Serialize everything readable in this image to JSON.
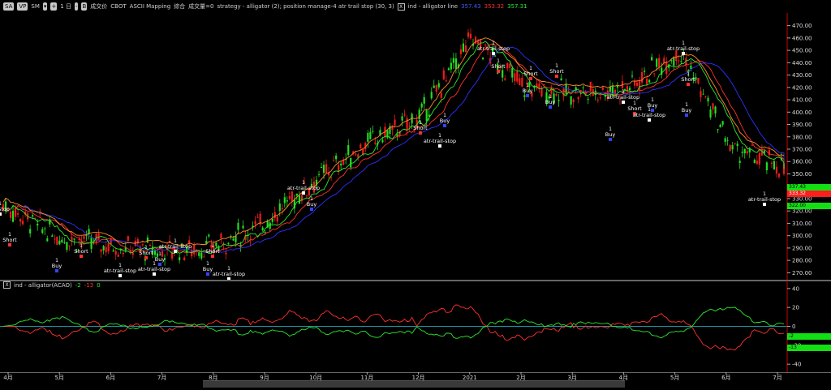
{
  "toolbar": {
    "symbol_btn": "SA",
    "vp_btn": "VP",
    "sm": "SM",
    "period": "1 日",
    "exchange": "成交价",
    "source": "CBOT",
    "mapping": "ASCII Mapping",
    "mode": "综合",
    "volume": "成交量=0",
    "strategy": "strategy - alligator (2); position manage-4 atr trail stop (30, 3)",
    "indicator": "ind - alligator line",
    "val_blue": "357.43",
    "val_red": "353.32",
    "val_green": "357.31",
    "checkbox_x": "X",
    "dropdown_arrow": "▾",
    "plus": "+",
    "minus": "-",
    "b": "B"
  },
  "oscillator": {
    "title": "ind - alligator(ACAO)",
    "v1": "-2",
    "v2": "-13",
    "v3": "0",
    "checkbox_x": "X"
  },
  "price_axis": [
    "470.00",
    "460.00",
    "450.00",
    "440.00",
    "430.00",
    "420.00",
    "410.00",
    "400.00",
    "390.00",
    "380.00",
    "370.00",
    "360.00",
    "350.00",
    "340.00",
    "330.00",
    "320.00",
    "310.00",
    "300.00",
    "290.00",
    "280.00",
    "270.00"
  ],
  "price_tags": {
    "green_top": "337.43",
    "red": "333.32",
    "green_bottom": "322.00"
  },
  "osc_axis": [
    "40",
    "20",
    "0",
    "-20",
    "-40"
  ],
  "osc_tags": {
    "top": "-2",
    "bottom": "-13"
  },
  "months": [
    "4月",
    "5月",
    "6月",
    "7月",
    "8月",
    "9月",
    "10月",
    "11月",
    "12月",
    "2021",
    "2月",
    "3月",
    "4月",
    "5月",
    "6月",
    "7月"
  ],
  "annotations": {
    "short": "Short",
    "buy": "Buy",
    "stop": "atr-trail-stop",
    "stop_cut": "ail-stop",
    "one": "1"
  },
  "colors": {
    "bull": "#22dd22",
    "bear": "#ee1c1c",
    "lips": "#2ee82e",
    "teeth": "#ff3030",
    "jaw": "#3030ff",
    "trail": "#ff8a30",
    "axis_red": "#d00000",
    "tag_green": "#12e012",
    "tag_red": "#ff1e1e"
  },
  "chart_data": {
    "type": "line",
    "x_months": [
      "4月",
      "5月",
      "6月",
      "7月",
      "8月",
      "9月",
      "10月",
      "11月",
      "12月",
      "2021",
      "2月",
      "3月",
      "4月",
      "5月",
      "6月",
      "7月"
    ],
    "price_series_approx": [
      325,
      300,
      292,
      288,
      290,
      310,
      345,
      375,
      395,
      460,
      420,
      415,
      420,
      450,
      370,
      355
    ],
    "ylim": [
      265,
      475
    ],
    "osc_ylim": [
      -45,
      45
    ]
  }
}
